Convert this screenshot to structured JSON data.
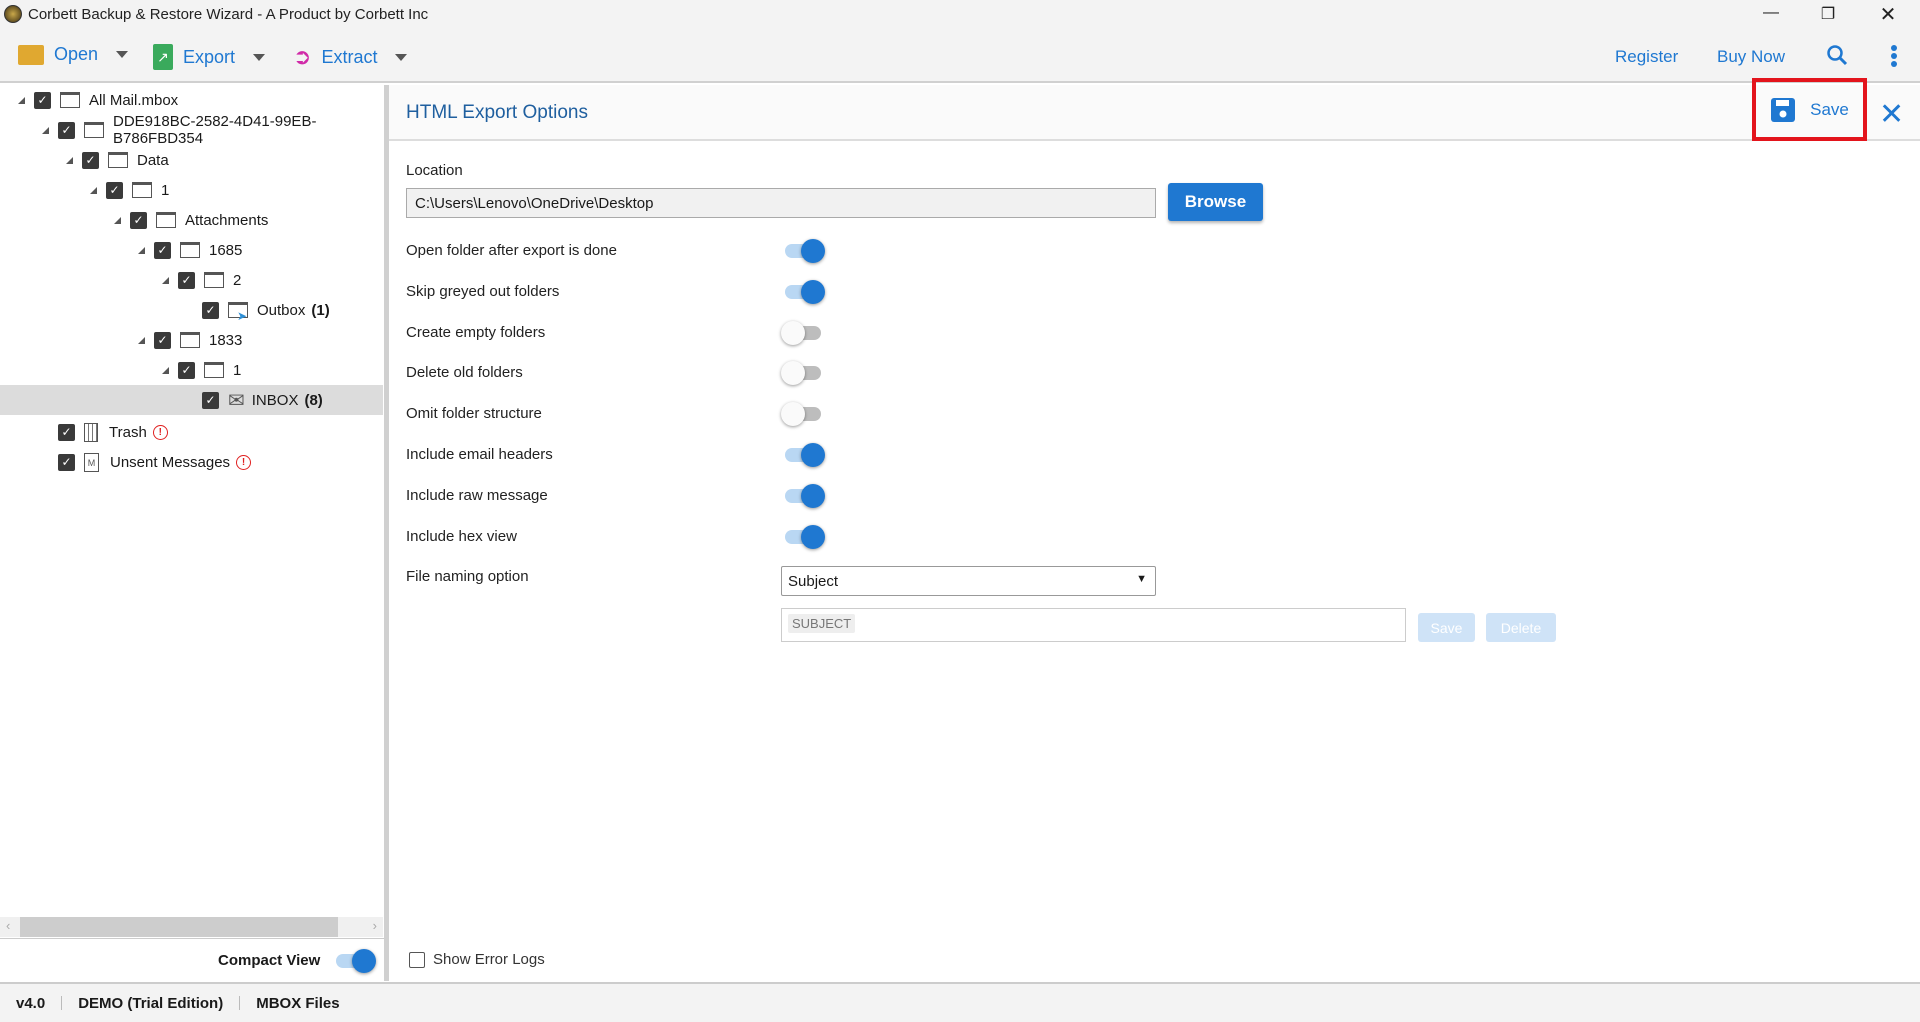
{
  "window": {
    "title": "Corbett Backup & Restore Wizard - A Product by Corbett Inc"
  },
  "toolbar": {
    "open": "Open",
    "export": "Export",
    "extract": "Extract",
    "register": "Register",
    "buy_now": "Buy Now"
  },
  "tree": [
    {
      "label": "All Mail.mbox",
      "level": 0,
      "arrow": true,
      "icon": "folder"
    },
    {
      "label": "DDE918BC-2582-4D41-99EB-B786FBD354",
      "level": 1,
      "arrow": true,
      "icon": "folder"
    },
    {
      "label": "Data",
      "level": 2,
      "arrow": true,
      "icon": "folder"
    },
    {
      "label": "1",
      "level": 3,
      "arrow": true,
      "icon": "folder"
    },
    {
      "label": "Attachments",
      "level": 4,
      "arrow": true,
      "icon": "folder"
    },
    {
      "label": "1685",
      "level": 5,
      "arrow": true,
      "icon": "folder"
    },
    {
      "label": "2",
      "level": 6,
      "arrow": true,
      "icon": "folder"
    },
    {
      "label": "Outbox",
      "count": "(1)",
      "level": 7,
      "arrow": false,
      "icon": "outbox"
    },
    {
      "label": "1833",
      "level": 5,
      "arrow": true,
      "icon": "folder"
    },
    {
      "label": "1",
      "level": 6,
      "arrow": true,
      "icon": "folder"
    },
    {
      "label": "INBOX",
      "count": "(8)",
      "level": 7,
      "arrow": false,
      "icon": "mail",
      "selected": true
    },
    {
      "label": "Trash",
      "level": 1,
      "arrow": false,
      "icon": "trash",
      "warning": true
    },
    {
      "label": "Unsent Messages",
      "level": 1,
      "arrow": false,
      "icon": "draft",
      "warning": true
    }
  ],
  "left_footer": {
    "compact_view": "Compact View",
    "compact_on": true
  },
  "panel": {
    "title": "HTML Export Options",
    "save": "Save",
    "location_label": "Location",
    "location_value": "C:\\Users\\Lenovo\\OneDrive\\Desktop",
    "browse": "Browse",
    "options": [
      {
        "label": "Open folder after export is done",
        "on": true
      },
      {
        "label": "Skip greyed out folders",
        "on": true
      },
      {
        "label": "Create empty folders",
        "on": false
      },
      {
        "label": "Delete old folders",
        "on": false
      },
      {
        "label": "Omit folder structure",
        "on": false
      },
      {
        "label": "Include email headers",
        "on": true
      },
      {
        "label": "Include raw message",
        "on": true
      },
      {
        "label": "Include hex view",
        "on": true
      }
    ],
    "file_naming_label": "File naming option",
    "file_naming_value": "Subject",
    "tag": "SUBJECT",
    "tag_save": "Save",
    "tag_delete": "Delete",
    "show_error_logs": "Show Error Logs"
  },
  "status": {
    "version": "v4.0",
    "edition": "DEMO (Trial Edition)",
    "type": "MBOX Files"
  },
  "colors": {
    "accent": "#1f78d1",
    "highlight": "#e3141c"
  }
}
